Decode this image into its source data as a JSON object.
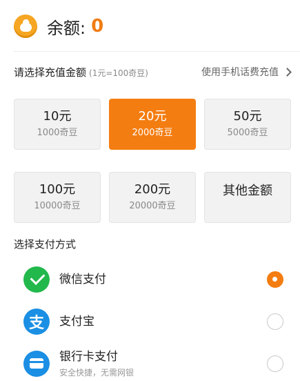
{
  "balance": {
    "label": "余额:",
    "value": "0",
    "icon": "coin-icon"
  },
  "recharge": {
    "title": "请选择充值金额",
    "rate": "(1元=100奇豆)",
    "phone_link": "使用手机话费充值",
    "amounts": [
      {
        "main": "10元",
        "sub": "1000奇豆",
        "selected": false
      },
      {
        "main": "20元",
        "sub": "2000奇豆",
        "selected": true
      },
      {
        "main": "50元",
        "sub": "5000奇豆",
        "selected": false
      },
      {
        "main": "100元",
        "sub": "10000奇豆",
        "selected": false
      },
      {
        "main": "200元",
        "sub": "20000奇豆",
        "selected": false
      },
      {
        "main": "其他金额",
        "sub": "",
        "selected": false
      }
    ]
  },
  "payment": {
    "title": "选择支付方式",
    "methods": [
      {
        "name": "微信支付",
        "desc": "",
        "icon": "wechat-pay-icon",
        "selected": true
      },
      {
        "name": "支付宝",
        "desc": "",
        "icon": "alipay-icon",
        "selected": false
      },
      {
        "name": "银行卡支付",
        "desc": "安全快捷，无需网银",
        "icon": "bank-card-icon",
        "selected": false
      }
    ]
  },
  "colors": {
    "accent": "#f47d11",
    "wechat": "#22b84c",
    "alipay": "#1a8fe4"
  }
}
